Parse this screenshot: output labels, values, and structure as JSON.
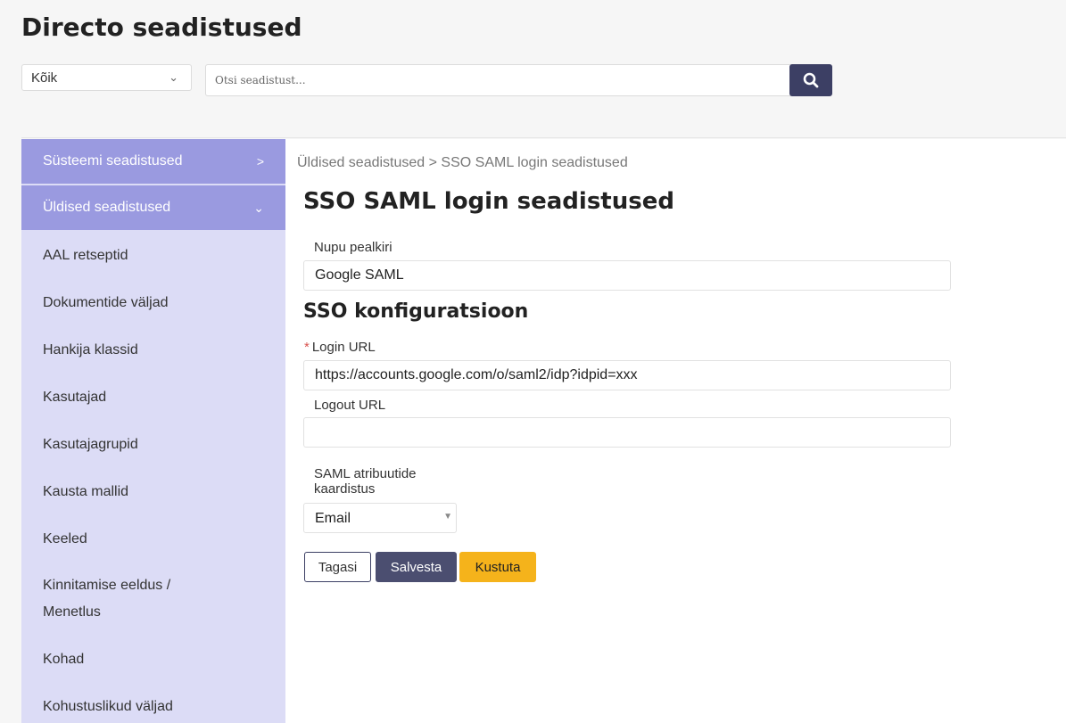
{
  "header": {
    "title": "Directo seadistused"
  },
  "filter": {
    "selected": "Kõik"
  },
  "search": {
    "placeholder": "Otsi seadistust...",
    "icon": "search-icon"
  },
  "sidebar": {
    "sections": [
      {
        "label": "Süsteemi seadistused",
        "arrow": ">"
      },
      {
        "label": "Üldised seadistused",
        "arrow": "⌄"
      }
    ],
    "items": [
      {
        "label": "AAL retseptid"
      },
      {
        "label": "Dokumentide väljad"
      },
      {
        "label": "Hankija klassid"
      },
      {
        "label": "Kasutajad"
      },
      {
        "label": "Kasutajagrupid"
      },
      {
        "label": "Kausta mallid"
      },
      {
        "label": "Keeled"
      },
      {
        "label": "Kinnitamise eeldus /",
        "label2": "Menetlus"
      },
      {
        "label": "Kohad"
      },
      {
        "label": "Kohustuslikud väljad"
      }
    ]
  },
  "breadcrumb": {
    "text": "Üldised seadistused > SSO SAML login seadistused"
  },
  "form": {
    "title": "SSO SAML login seadistused",
    "button_title_label": "Nupu pealkiri",
    "button_title_value": "Google SAML",
    "config_title": "SSO konfiguratsioon",
    "required_mark": "*",
    "login_url_label": "Login URL",
    "login_url_value": "https://accounts.google.com/o/saml2/idp?idpid=xxx",
    "logout_url_label": "Logout URL",
    "logout_url_value": "",
    "mapping_label_1": "SAML atribuutide",
    "mapping_label_2": "kaardistus",
    "mapping_value": "Email"
  },
  "buttons": {
    "back": "Tagasi",
    "save": "Salvesta",
    "delete": "Kustuta"
  },
  "colors": {
    "sidebar_bg": "#dcdcf6",
    "sidebar_active": "#9a9ae0",
    "primary": "#3c3f64",
    "warning": "#f5b31b"
  }
}
